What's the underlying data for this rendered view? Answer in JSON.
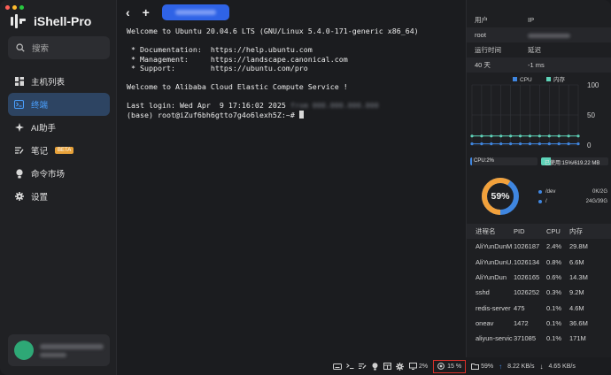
{
  "app": {
    "name": "iShell-Pro"
  },
  "traffic_colors": [
    "#ff5f57",
    "#febc2e",
    "#28c840"
  ],
  "search": {
    "placeholder": "搜索"
  },
  "nav": [
    {
      "label": "主机列表",
      "icon": "hosts-icon",
      "active": false
    },
    {
      "label": "终端",
      "icon": "terminal-icon",
      "active": true
    },
    {
      "label": "AI助手",
      "icon": "ai-icon",
      "active": false
    },
    {
      "label": "笔记",
      "icon": "notes-icon",
      "active": false,
      "badge": "BETA"
    },
    {
      "label": "命令市场",
      "icon": "market-icon",
      "active": false
    },
    {
      "label": "设置",
      "icon": "settings-icon",
      "active": false
    }
  ],
  "tabs": {
    "back": "‹",
    "add": "+"
  },
  "terminal": {
    "line1": "Welcome to Ubuntu 20.04.6 LTS (GNU/Linux 5.4.0-171-generic x86_64)",
    "line2": " * Documentation:  https://help.ubuntu.com",
    "line3": " * Management:     https://landscape.canonical.com",
    "line4": " * Support:        https://ubuntu.com/pro",
    "line5": "Welcome to Alibaba Cloud Elastic Compute Service !",
    "line6": "Last login: Wed Apr  9 17:16:02 2025",
    "line7": "(base) root@iZuf6bh6gtto7g4o6lexh5Z:~# "
  },
  "info": {
    "h_user": "用户",
    "h_ip": "IP",
    "user": "root",
    "h_uptime": "运行时间",
    "h_latency": "延迟",
    "uptime": "40 天",
    "latency": "-1 ms"
  },
  "chart_data": {
    "type": "line",
    "series": [
      {
        "name": "CPU",
        "values": [
          2,
          2,
          2,
          2,
          2,
          2,
          2,
          2,
          2,
          2,
          2,
          2
        ]
      },
      {
        "name": "内存",
        "values": [
          15,
          15,
          15,
          15,
          15,
          15,
          15,
          15,
          15,
          15,
          15,
          15
        ]
      }
    ],
    "ylim": [
      0,
      100
    ],
    "yticks": [
      "100",
      "50",
      "0"
    ],
    "grid": true,
    "legend": "top",
    "colors": {
      "cpu": "#3f86e0",
      "mem": "#5ed3b8"
    }
  },
  "usage": {
    "cpu_label": "CPU:2%",
    "cpu_fraction": 0.02,
    "mem_label": "已使用:15%/619.22 MB",
    "mem_fraction": 0.15
  },
  "disk": {
    "percent_label": "59%",
    "fraction": 0.59,
    "colors": {
      "used": "#f2a13b",
      "free": "#3f86e0"
    },
    "rows": [
      {
        "path": "/dev",
        "size": "0K/2G"
      },
      {
        "path": "/",
        "size": "24G/39G"
      }
    ]
  },
  "process": {
    "headers": [
      "进程名",
      "PID",
      "CPU",
      "内存"
    ],
    "rows": [
      [
        "AliYunDunM...",
        "1026187",
        "2.4%",
        "29.8M"
      ],
      [
        "AliYunDunU...",
        "1026134",
        "0.8%",
        "6.6M"
      ],
      [
        "AliYunDun",
        "1026165",
        "0.6%",
        "14.3M"
      ],
      [
        "sshd",
        "1026252",
        "0.3%",
        "9.2M"
      ],
      [
        "redis-server",
        "475",
        "0.1%",
        "4.6M"
      ],
      [
        "oneav",
        "1472",
        "0.1%",
        "36.6M"
      ],
      [
        "aliyun-service",
        "371085",
        "0.1%",
        "171M"
      ]
    ]
  },
  "status": {
    "cpu": "2%",
    "mem": "15 %",
    "disk": "59%",
    "up": "8.22 KB/s",
    "down": "4.65 KB/s"
  }
}
